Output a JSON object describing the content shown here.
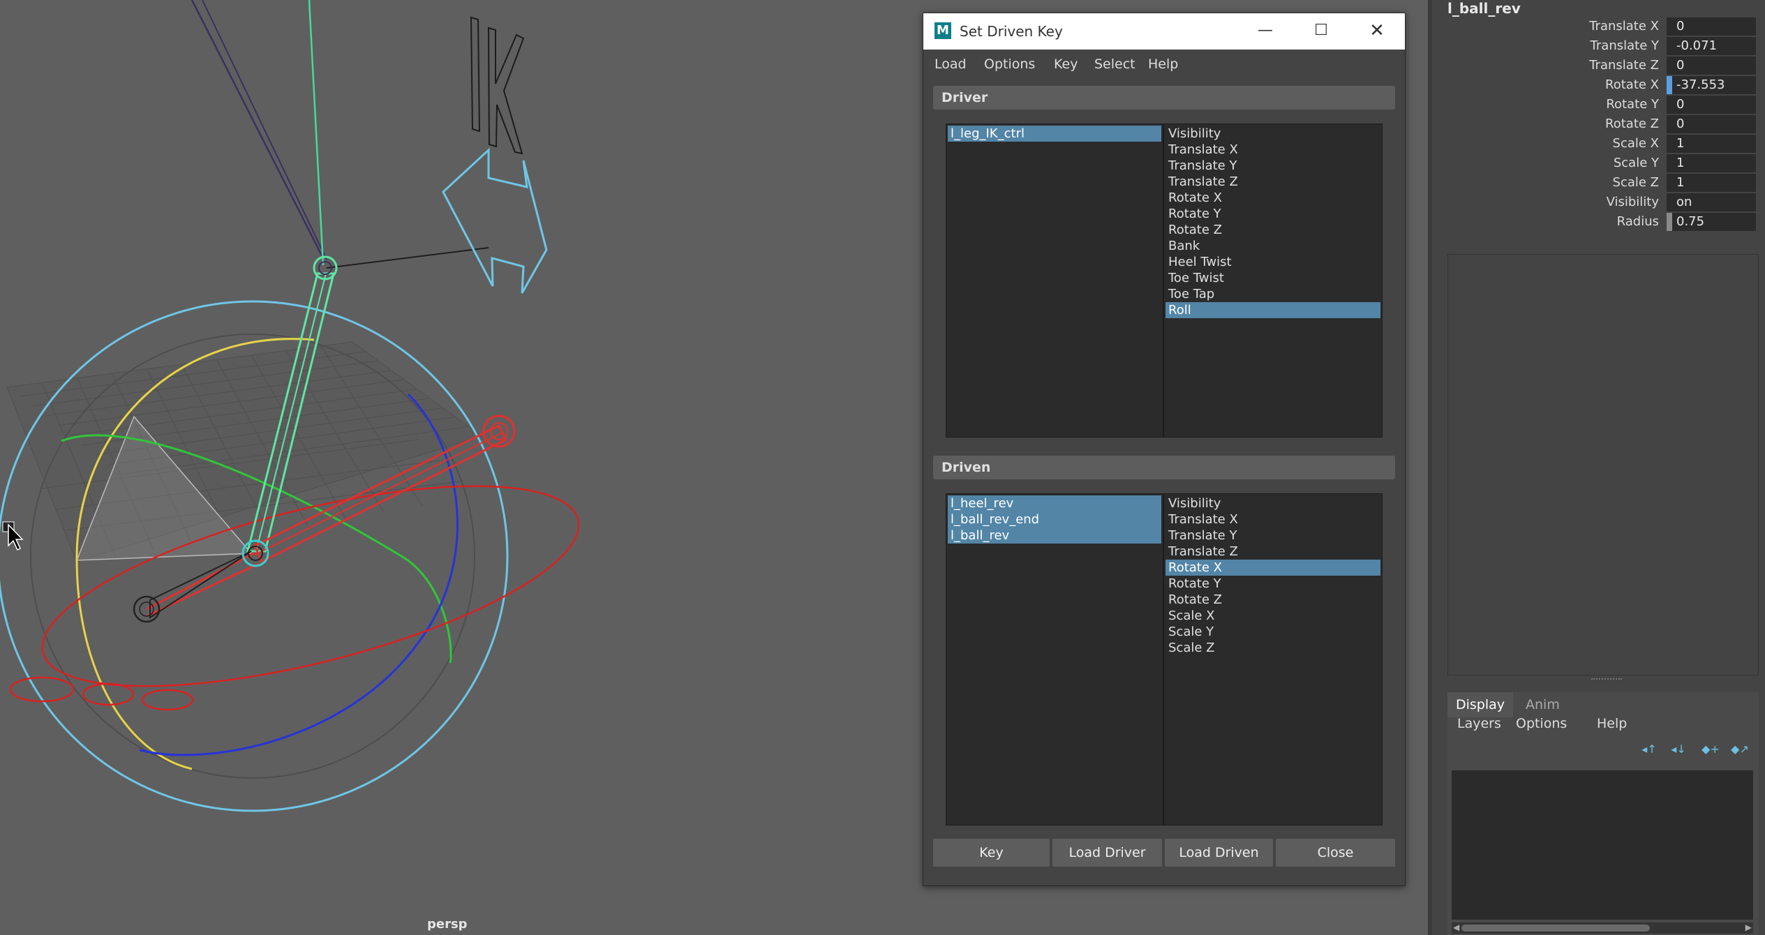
{
  "viewport": {
    "camera_label": "persp",
    "ik_label": "IK"
  },
  "sdk": {
    "title": "Set Driven Key",
    "app_icon": "M",
    "menu": [
      "Load",
      "Options",
      "Key",
      "Select",
      "Help"
    ],
    "driver": {
      "header": "Driver",
      "objects": [
        {
          "label": "l_leg_IK_ctrl",
          "selected": true
        }
      ],
      "attributes": [
        {
          "label": "Visibility",
          "selected": false
        },
        {
          "label": "Translate X",
          "selected": false
        },
        {
          "label": "Translate Y",
          "selected": false
        },
        {
          "label": "Translate Z",
          "selected": false
        },
        {
          "label": "Rotate X",
          "selected": false
        },
        {
          "label": "Rotate Y",
          "selected": false
        },
        {
          "label": "Rotate Z",
          "selected": false
        },
        {
          "label": "Bank",
          "selected": false
        },
        {
          "label": "Heel Twist",
          "selected": false
        },
        {
          "label": "Toe Twist",
          "selected": false
        },
        {
          "label": "Toe Tap",
          "selected": false
        },
        {
          "label": "Roll",
          "selected": true
        }
      ]
    },
    "driven": {
      "header": "Driven",
      "objects": [
        {
          "label": "l_heel_rev",
          "selected": true
        },
        {
          "label": "l_ball_rev_end",
          "selected": true
        },
        {
          "label": "l_ball_rev",
          "selected": true
        }
      ],
      "attributes": [
        {
          "label": "Visibility",
          "selected": false
        },
        {
          "label": "Translate X",
          "selected": false
        },
        {
          "label": "Translate Y",
          "selected": false
        },
        {
          "label": "Translate Z",
          "selected": false
        },
        {
          "label": "Rotate X",
          "selected": true
        },
        {
          "label": "Rotate Y",
          "selected": false
        },
        {
          "label": "Rotate Z",
          "selected": false
        },
        {
          "label": "Scale X",
          "selected": false
        },
        {
          "label": "Scale Y",
          "selected": false
        },
        {
          "label": "Scale Z",
          "selected": false
        }
      ]
    },
    "buttons": {
      "key": "Key",
      "load_driver": "Load Driver",
      "load_driven": "Load Driven",
      "close": "Close"
    }
  },
  "channel_box": {
    "object_name": "l_ball_rev",
    "attributes": [
      {
        "label": "Translate X",
        "value": "0"
      },
      {
        "label": "Translate Y",
        "value": "-0.071"
      },
      {
        "label": "Translate Z",
        "value": "0"
      },
      {
        "label": "Rotate X",
        "value": "-37.553",
        "mark_color": "#5aa0e0"
      },
      {
        "label": "Rotate Y",
        "value": "0"
      },
      {
        "label": "Rotate Z",
        "value": "0"
      },
      {
        "label": "Scale X",
        "value": "1"
      },
      {
        "label": "Scale Y",
        "value": "1"
      },
      {
        "label": "Scale Z",
        "value": "1"
      },
      {
        "label": "Visibility",
        "value": "on"
      },
      {
        "label": "Radius",
        "value": "0.75",
        "mark_color": "#8a8a8a"
      }
    ]
  },
  "layer_editor": {
    "tabs": [
      "Display",
      "Anim"
    ],
    "menu": [
      "Layers",
      "Options",
      "Help"
    ],
    "tools": [
      "move-layer-up-icon",
      "move-layer-down-icon",
      "new-layer-icon",
      "new-layer-from-selection-icon"
    ]
  },
  "colors": {
    "selection": "#5285a6",
    "panel": "#444444",
    "viewport": "#5f5f5f"
  }
}
